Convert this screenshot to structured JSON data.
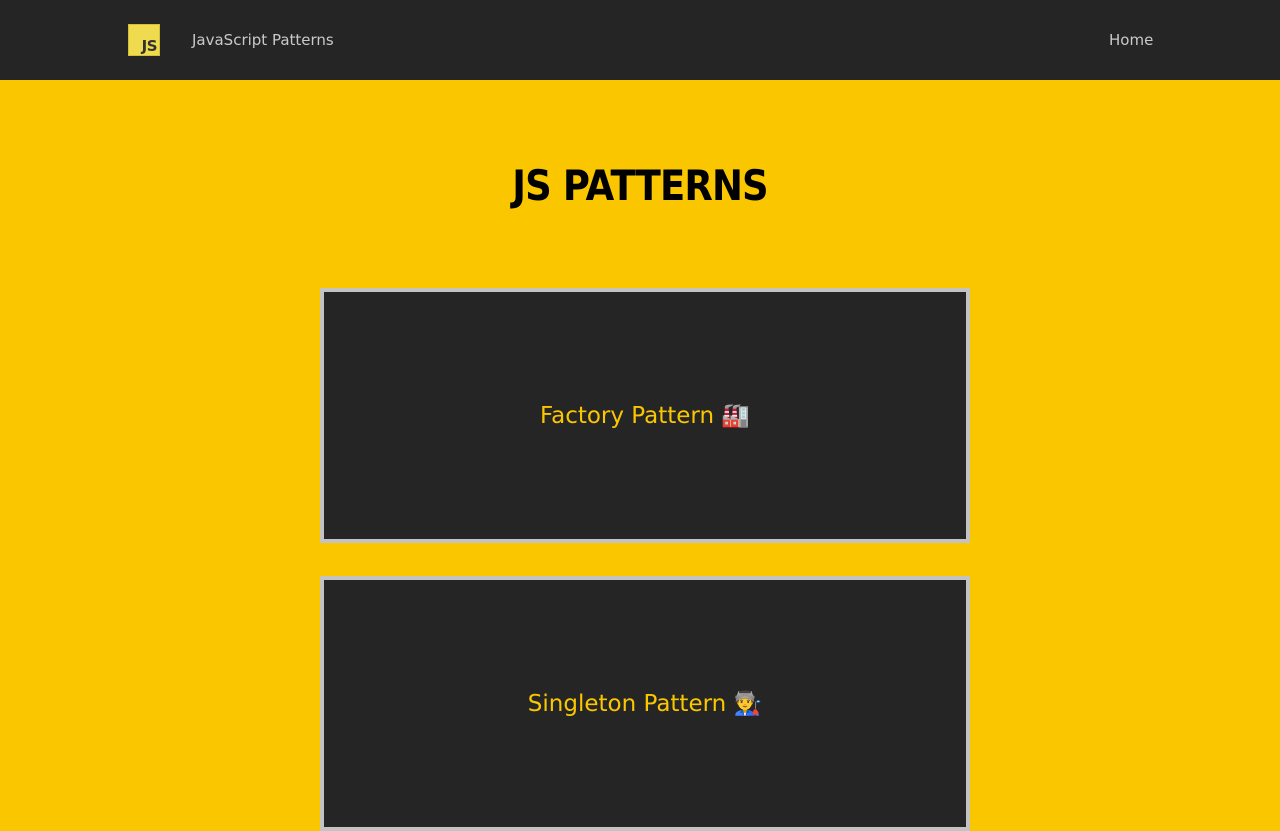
{
  "navbar": {
    "logo_text": "JS",
    "brand": "JavaScript Patterns",
    "home_link": "Home"
  },
  "main": {
    "title": "JS PATTERNS",
    "cards": [
      {
        "label": "Factory Pattern 🏭"
      },
      {
        "label": "Singleton Pattern 👨‍🏭"
      }
    ]
  },
  "colors": {
    "background": "#f9c600",
    "navbar": "#252525",
    "card_background": "#252525",
    "card_border": "#c3c3c3",
    "card_text": "#f9c600",
    "logo": "#f0db4f"
  },
  "icons": {
    "logo": "javascript-logo-icon"
  }
}
